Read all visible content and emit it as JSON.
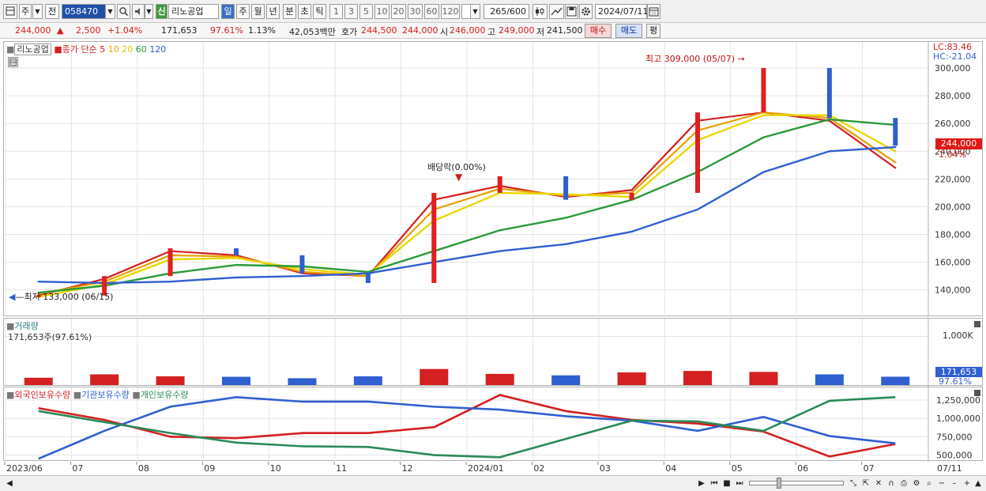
{
  "toolbar": {
    "type_label": "주",
    "prev_label": "전",
    "code": "058470",
    "info_badge": "신",
    "stock_name": "리노공업",
    "periods": [
      "일",
      "주",
      "월",
      "년",
      "분",
      "초",
      "틱"
    ],
    "active_period": "일",
    "minute_steps": [
      "1",
      "3",
      "5",
      "10",
      "20",
      "30",
      "60",
      "120"
    ],
    "count": "265",
    "count_max": "/600",
    "date": "2024/07/11"
  },
  "quote": {
    "price": "244,000",
    "arrow": "▲",
    "change": "2,500",
    "change_pct": "+1.04%",
    "volume": "171,653",
    "volume_ratio": "97.61%",
    "turnover": "1.13%",
    "amount": "42,053백만",
    "bid_label": "호가",
    "bid1": "244,500",
    "bid2": "244,000",
    "open_label": "시",
    "open": "246,000",
    "high_label": "고",
    "high": "249,000",
    "low_label": "저",
    "low": "241,500",
    "buy_btn": "매수",
    "sell_btn": "매도",
    "eval_btn": "평"
  },
  "price_panel": {
    "name": "리노공업",
    "indicator": "종가 단순",
    "ma_labels": [
      "5",
      "10",
      "20",
      "60",
      "120"
    ],
    "ma_colors": [
      "#d42020",
      "#e8a000",
      "#e8d800",
      "#2a9a3a",
      "#2f5fd0"
    ],
    "lc": "LC:83.46",
    "hc": "HC:-21.04",
    "y_ticks": [
      "300,000",
      "280,000",
      "260,000",
      "240,000",
      "220,000",
      "200,000",
      "180,000",
      "160,000",
      "140,000"
    ],
    "last_price": "244,000",
    "last_pct": "1.04%",
    "max_note": "최고 309,000 (05/07)",
    "min_note": "최저 133,000 (06/15)",
    "dividend_note": "배당락(0.00%)"
  },
  "volume_panel": {
    "title": "거래량",
    "info": "171,653주(97.61%)",
    "y_tick": "1,000K",
    "last_value": "171,653",
    "last_pct": "97.61%"
  },
  "holdings_panel": {
    "titles": [
      "외국인보유수량",
      "기관보유수량",
      "개인보유수량"
    ],
    "colors": [
      "#d42020",
      "#2f5fd0",
      "#2a8a5a"
    ],
    "y_ticks": [
      "1,250,000",
      "1,000,000",
      "750,000",
      "500,000"
    ]
  },
  "x_axis": [
    "2023/06",
    "07",
    "08",
    "09",
    "10",
    "11",
    "12",
    "2024/01",
    "02",
    "03",
    "04",
    "05",
    "06",
    "07",
    "07/11"
  ],
  "chart_data": [
    {
      "type": "line",
      "title": "리노공업 종가 단순 5 10 20 60 120",
      "categories": [
        "2023/06",
        "07",
        "08",
        "09",
        "10",
        "11",
        "12",
        "2024/01",
        "02",
        "03",
        "04",
        "05",
        "06",
        "07"
      ],
      "ylim": [
        125000,
        312000
      ],
      "series": [
        {
          "name": "5",
          "values": [
            136000,
            148000,
            168000,
            165000,
            152000,
            150000,
            205000,
            215000,
            207000,
            212000,
            262000,
            268000,
            262000,
            228000
          ]
        },
        {
          "name": "10",
          "values": [
            137000,
            146000,
            165000,
            164000,
            153000,
            150000,
            198000,
            213000,
            208000,
            210000,
            255000,
            268000,
            264000,
            232000
          ]
        },
        {
          "name": "20",
          "values": [
            135000,
            144000,
            162000,
            163000,
            155000,
            151000,
            190000,
            210000,
            209000,
            207000,
            248000,
            266000,
            266000,
            240000
          ]
        },
        {
          "name": "60",
          "values": [
            138000,
            143000,
            152000,
            158000,
            157000,
            153000,
            168000,
            183000,
            192000,
            205000,
            225000,
            250000,
            263000,
            259000
          ]
        },
        {
          "name": "120",
          "values": [
            146000,
            145000,
            146000,
            149000,
            150000,
            152000,
            160000,
            168000,
            173000,
            182000,
            198000,
            225000,
            240000,
            243000
          ]
        }
      ],
      "close": [
        136000,
        150000,
        170000,
        165000,
        152000,
        145000,
        210000,
        222000,
        205000,
        210000,
        268000,
        300000,
        264000,
        244000
      ],
      "high_point": {
        "label": "05/07",
        "value": 309000
      },
      "low_point": {
        "label": "06/15",
        "value": 133000
      }
    },
    {
      "type": "bar",
      "title": "거래량",
      "categories": [
        "2023/06",
        "07",
        "08",
        "09",
        "10",
        "11",
        "12",
        "2024/01",
        "02",
        "03",
        "04",
        "05",
        "06",
        "07"
      ],
      "ylim": [
        0,
        1300000
      ],
      "values": [
        150000,
        220000,
        180000,
        170000,
        140000,
        180000,
        330000,
        230000,
        200000,
        260000,
        290000,
        270000,
        220000,
        171653
      ]
    },
    {
      "type": "line",
      "title": "외국인보유수량 기관보유수량 개인보유수량",
      "categories": [
        "2023/06",
        "07",
        "08",
        "09",
        "10",
        "11",
        "12",
        "2024/01",
        "02",
        "03",
        "04",
        "05",
        "06",
        "07"
      ],
      "ylim": [
        430000,
        1380000
      ],
      "series": [
        {
          "name": "외국인보유수량",
          "values": [
            1140000,
            980000,
            750000,
            730000,
            800000,
            800000,
            880000,
            1320000,
            1100000,
            980000,
            930000,
            820000,
            480000,
            650000
          ]
        },
        {
          "name": "기관보유수량",
          "values": [
            450000,
            830000,
            1160000,
            1290000,
            1230000,
            1230000,
            1160000,
            1120000,
            1030000,
            970000,
            830000,
            1020000,
            760000,
            660000
          ]
        },
        {
          "name": "개인보유수량",
          "values": [
            1100000,
            950000,
            800000,
            670000,
            620000,
            610000,
            500000,
            470000,
            720000,
            970000,
            960000,
            830000,
            1240000,
            1290000
          ]
        }
      ]
    }
  ]
}
